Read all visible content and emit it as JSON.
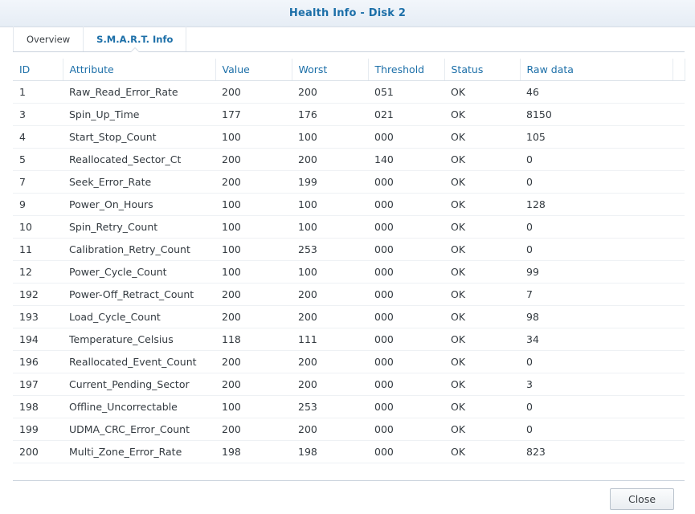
{
  "window": {
    "title": "Health Info - Disk 2"
  },
  "tabs": [
    {
      "label": "Overview",
      "active": false
    },
    {
      "label": "S.M.A.R.T. Info",
      "active": true
    }
  ],
  "table": {
    "columns": [
      "ID",
      "Attribute",
      "Value",
      "Worst",
      "Threshold",
      "Status",
      "Raw data"
    ],
    "rows": [
      [
        "1",
        "Raw_Read_Error_Rate",
        "200",
        "200",
        "051",
        "OK",
        "46"
      ],
      [
        "3",
        "Spin_Up_Time",
        "177",
        "176",
        "021",
        "OK",
        "8150"
      ],
      [
        "4",
        "Start_Stop_Count",
        "100",
        "100",
        "000",
        "OK",
        "105"
      ],
      [
        "5",
        "Reallocated_Sector_Ct",
        "200",
        "200",
        "140",
        "OK",
        "0"
      ],
      [
        "7",
        "Seek_Error_Rate",
        "200",
        "199",
        "000",
        "OK",
        "0"
      ],
      [
        "9",
        "Power_On_Hours",
        "100",
        "100",
        "000",
        "OK",
        "128"
      ],
      [
        "10",
        "Spin_Retry_Count",
        "100",
        "100",
        "000",
        "OK",
        "0"
      ],
      [
        "11",
        "Calibration_Retry_Count",
        "100",
        "253",
        "000",
        "OK",
        "0"
      ],
      [
        "12",
        "Power_Cycle_Count",
        "100",
        "100",
        "000",
        "OK",
        "99"
      ],
      [
        "192",
        "Power-Off_Retract_Count",
        "200",
        "200",
        "000",
        "OK",
        "7"
      ],
      [
        "193",
        "Load_Cycle_Count",
        "200",
        "200",
        "000",
        "OK",
        "98"
      ],
      [
        "194",
        "Temperature_Celsius",
        "118",
        "111",
        "000",
        "OK",
        "34"
      ],
      [
        "196",
        "Reallocated_Event_Count",
        "200",
        "200",
        "000",
        "OK",
        "0"
      ],
      [
        "197",
        "Current_Pending_Sector",
        "200",
        "200",
        "000",
        "OK",
        "3"
      ],
      [
        "198",
        "Offline_Uncorrectable",
        "100",
        "253",
        "000",
        "OK",
        "0"
      ],
      [
        "199",
        "UDMA_CRC_Error_Count",
        "200",
        "200",
        "000",
        "OK",
        "0"
      ],
      [
        "200",
        "Multi_Zone_Error_Rate",
        "198",
        "198",
        "000",
        "OK",
        "823"
      ]
    ]
  },
  "footer": {
    "close_label": "Close"
  },
  "colors": {
    "accent": "#1c6fa8",
    "text": "#333a40"
  }
}
